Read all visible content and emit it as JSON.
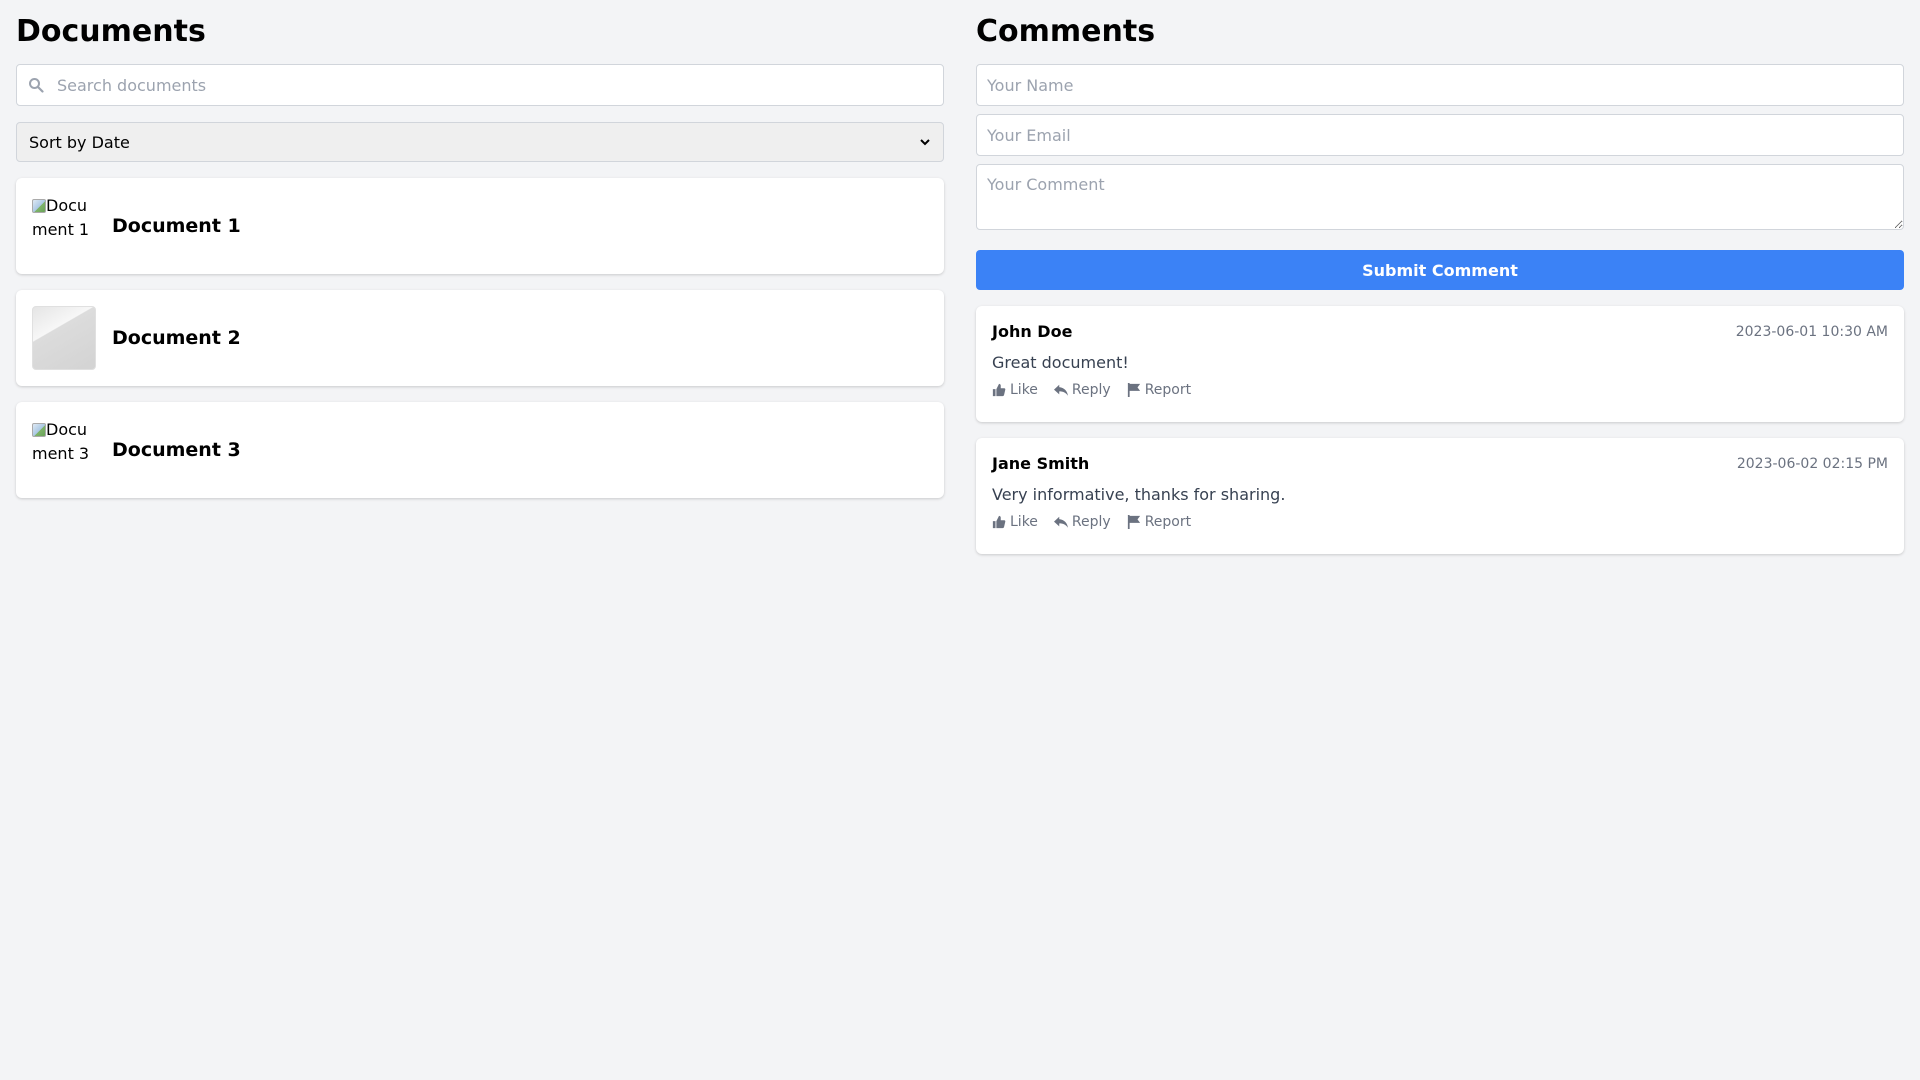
{
  "documents": {
    "title": "Documents",
    "search_placeholder": "Search documents",
    "sort_selected": "Sort by Date",
    "items": [
      {
        "title": "Document 1",
        "thumb_alt": "Document 1"
      },
      {
        "title": "Document 2"
      },
      {
        "title": "Document 3",
        "thumb_alt": "Document 3"
      }
    ]
  },
  "comments": {
    "title": "Comments",
    "name_placeholder": "Your Name",
    "email_placeholder": "Your Email",
    "comment_placeholder": "Your Comment",
    "submit_label": "Submit Comment",
    "items": [
      {
        "author": "John Doe",
        "time": "2023-06-01 10:30 AM",
        "text": "Great document!"
      },
      {
        "author": "Jane Smith",
        "time": "2023-06-02 02:15 PM",
        "text": "Very informative, thanks for sharing."
      }
    ],
    "actions": {
      "like": "Like",
      "reply": "Reply",
      "report": "Report"
    }
  },
  "colors": {
    "accent": "#3b82f6",
    "background": "#f3f4f6"
  },
  "icons": {
    "search": "search-icon",
    "like": "thumbs-up-icon",
    "reply": "reply-icon",
    "report": "flag-icon",
    "select": "chevron-down-icon"
  }
}
